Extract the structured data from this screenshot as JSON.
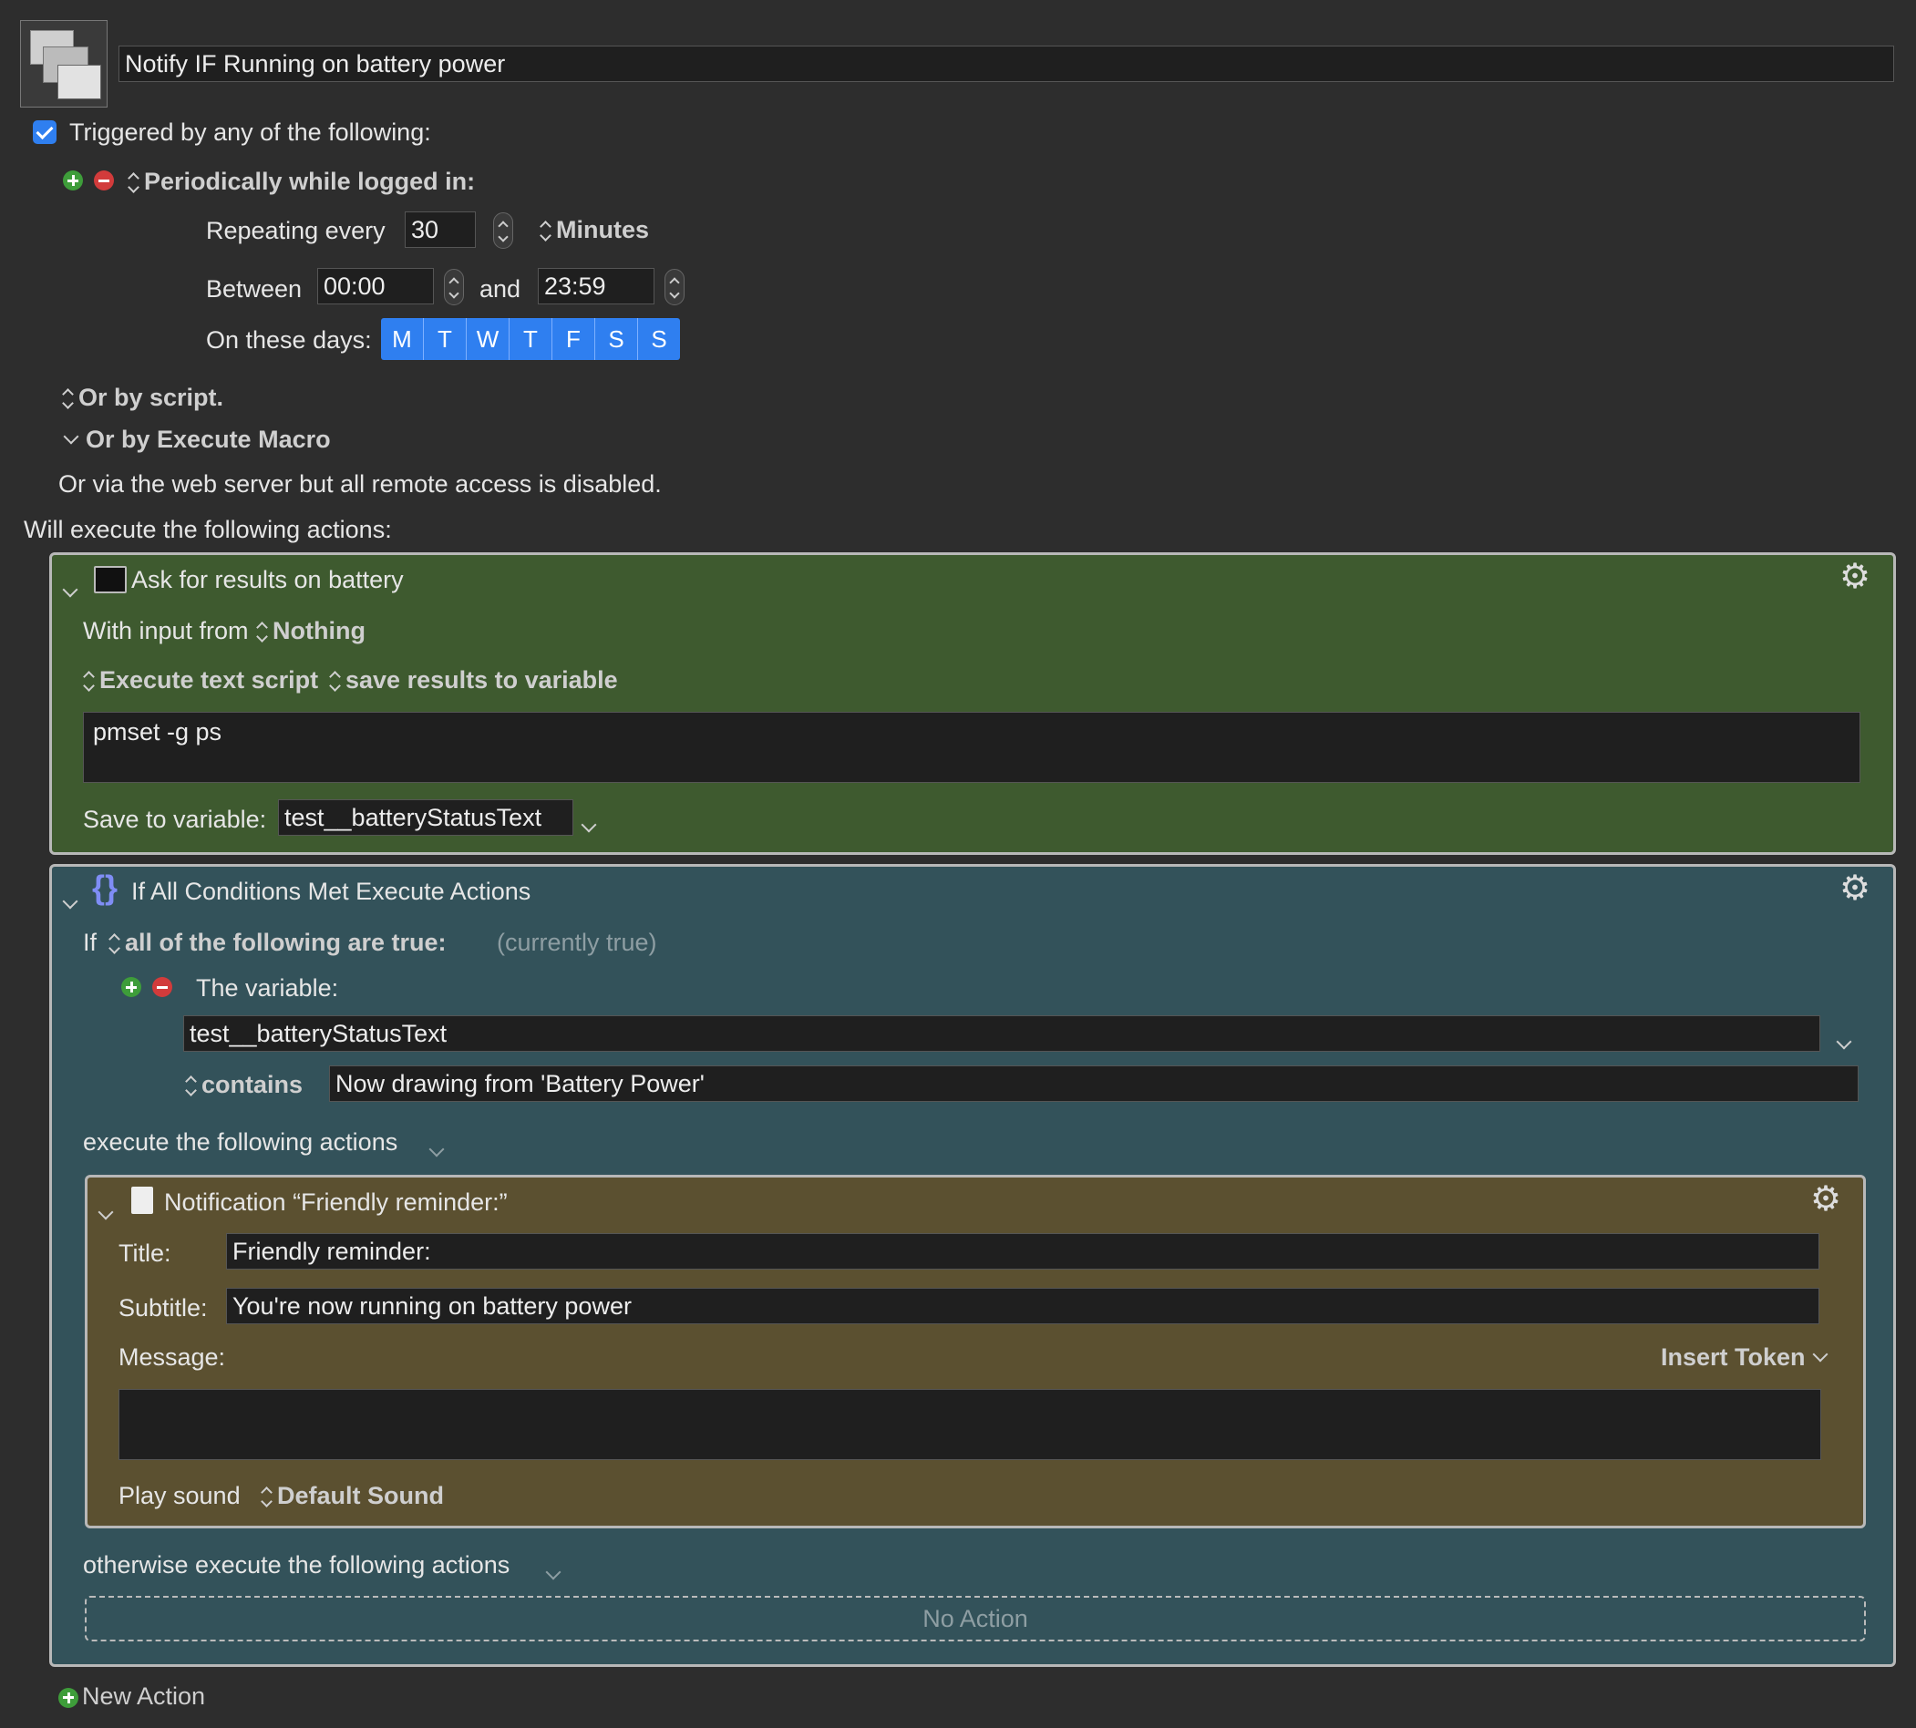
{
  "macro": {
    "name": "Notify IF Running on battery power",
    "triggered_label": "Triggered by any of the following:",
    "triggered_checked": true
  },
  "trigger": {
    "type_label": "Periodically while logged in:",
    "repeat_label": "Repeating every",
    "repeat_value": "30",
    "unit_label": "Minutes",
    "between_label": "Between",
    "start_time": "00:00",
    "and_label": "and",
    "end_time": "23:59",
    "days_label": "On these days:",
    "days": [
      "M",
      "T",
      "W",
      "T",
      "F",
      "S",
      "S"
    ]
  },
  "other_triggers": {
    "script_label": "Or by script.",
    "execute_macro_label": "Or by Execute Macro",
    "web_server_text": "Or via the web server but all remote access is disabled."
  },
  "actions_header": "Will execute the following actions:",
  "action1": {
    "title": "Ask for results on battery",
    "input_label": "With input from",
    "input_value": "Nothing",
    "script_type": "Execute text script",
    "result_mode": "save results to variable",
    "script": "pmset -g ps",
    "save_label": "Save to variable:",
    "variable": "test__batteryStatusText",
    "color": "#3e5a2f"
  },
  "action2": {
    "title": "If All Conditions Met Execute Actions",
    "if_label": "If",
    "condition_mode": "all of the following are true:",
    "status": "(currently true)",
    "condition_label": "The variable:",
    "variable": "test__batteryStatusText",
    "operator": "contains",
    "value": "Now drawing from 'Battery Power'",
    "then_label": "execute the following actions",
    "else_label": "otherwise execute the following actions",
    "no_action": "No Action",
    "color": "#33525a"
  },
  "action3": {
    "title": "Notification “Friendly reminder:”",
    "title_label": "Title:",
    "title_value": "Friendly reminder:",
    "subtitle_label": "Subtitle:",
    "subtitle_value": "You're now running on battery power",
    "message_label": "Message:",
    "message_value": "",
    "insert_token": "Insert Token",
    "sound_label": "Play sound",
    "sound_value": "Default Sound",
    "color": "#5b5030"
  },
  "new_action": "New Action",
  "colors": {
    "accent": "#2f7ff0",
    "background": "#2d2d2d"
  }
}
